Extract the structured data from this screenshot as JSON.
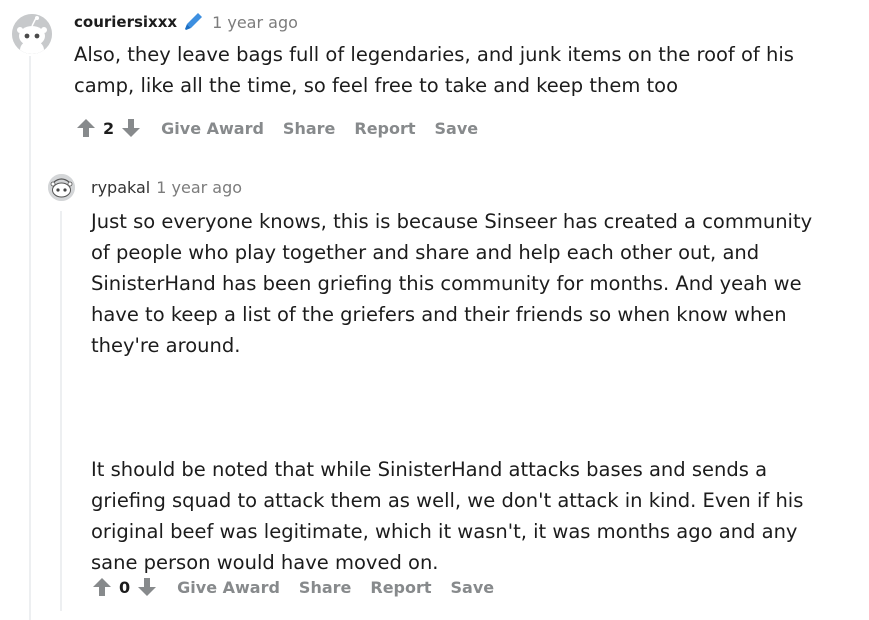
{
  "comment1": {
    "username": "couriersixxx",
    "time": "1 year ago",
    "body": "Also, they leave bags full of legendaries, and junk items on the roof of his camp, like all the time, so feel free to take and keep them too",
    "score": "2",
    "actions": {
      "give_award": "Give Award",
      "share": "Share",
      "report": "Report",
      "save": "Save"
    }
  },
  "comment2": {
    "username": "rypakal",
    "time": "1 year ago",
    "paragraphs": [
      "Just so everyone knows, this is because Sinseer has created a community of people who play together and share and help each other out, and SinisterHand has been griefing this community for months. And yeah we have to keep a list of the griefers and their friends so when know when they're around.",
      "It should be noted that while SinisterHand attacks bases and sends a griefing squad to attack them as well, we don't attack in kind. Even if his original beef was legitimate, which it wasn't, it was months ago and any sane person would have moved on."
    ],
    "score": "0",
    "actions": {
      "give_award": "Give Award",
      "share": "Share",
      "report": "Report",
      "save": "Save"
    }
  }
}
